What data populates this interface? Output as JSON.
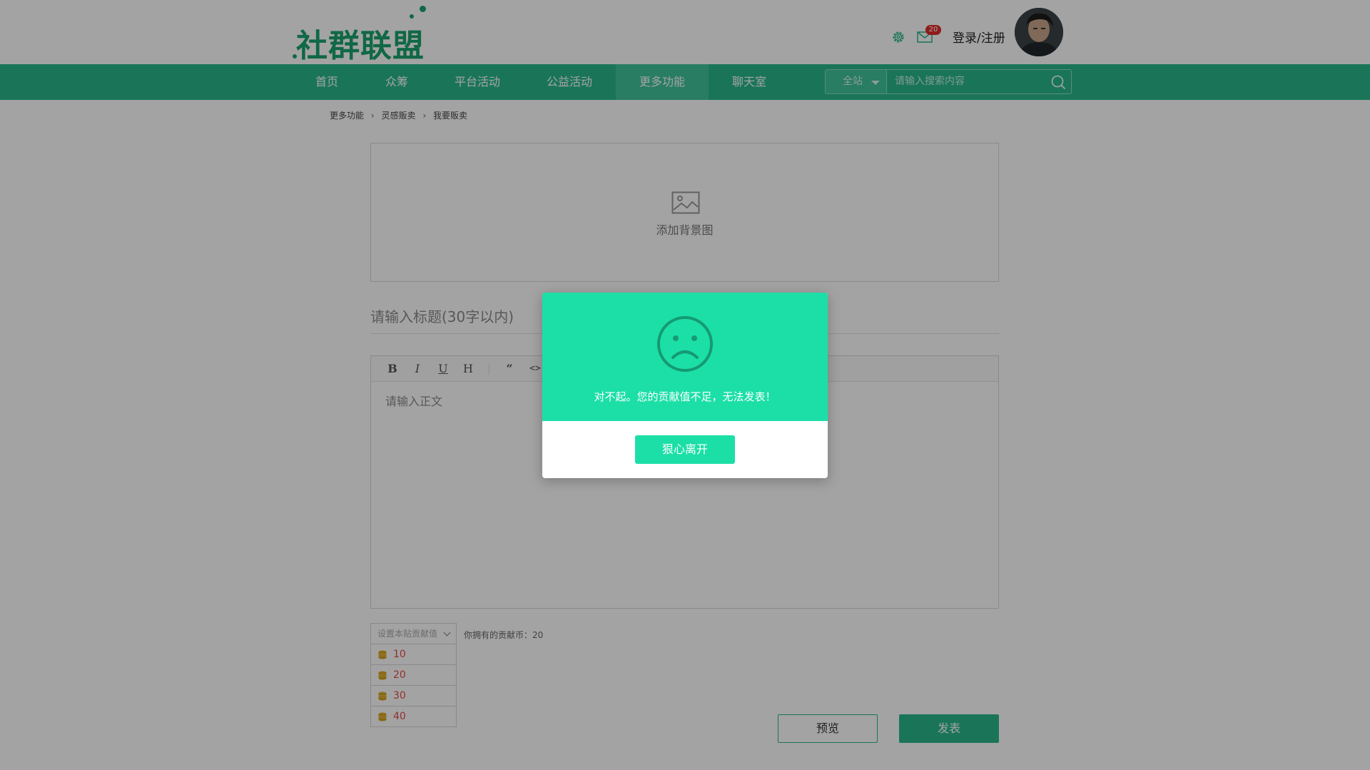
{
  "header": {
    "logo_text": "社群联盟",
    "mail_badge": "20",
    "login_label": "登录/注册"
  },
  "nav": {
    "items": [
      {
        "label": "首页",
        "active": false
      },
      {
        "label": "众筹",
        "active": false
      },
      {
        "label": "平台活动",
        "active": false
      },
      {
        "label": "公益活动",
        "active": false
      },
      {
        "label": "更多功能",
        "active": true
      },
      {
        "label": "聊天室",
        "active": false
      }
    ],
    "search": {
      "scope": "全站",
      "placeholder": "请输入搜索内容"
    }
  },
  "breadcrumb": [
    "更多功能",
    "灵感贩卖",
    "我要贩卖"
  ],
  "editor": {
    "bg_upload_label": "添加背景图",
    "title_placeholder": "请输入标题(30字以内)",
    "toolbar": [
      "B",
      "I",
      "U",
      "H",
      "“",
      "<>"
    ],
    "body_placeholder": "请输入正文"
  },
  "contribution": {
    "select_placeholder": "设置本贴贡献值",
    "options": [
      "10",
      "20",
      "30",
      "40"
    ],
    "balance_text": "你拥有的贡献币：20"
  },
  "actions": {
    "preview_label": "预览",
    "publish_label": "发表"
  },
  "modal": {
    "message": "对不起。您的贡献值不足，无法发表！",
    "button_label": "狠心离开"
  },
  "colors": {
    "brand": "#2ab88a",
    "modal_accent": "#1bdfa7",
    "coin_red": "#e84a4a",
    "badge_red": "#e02b2b"
  }
}
